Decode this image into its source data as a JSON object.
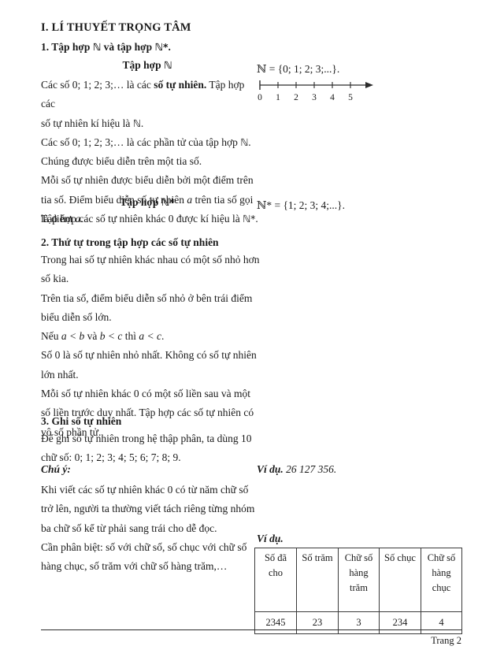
{
  "document": {
    "title": "I. LÍ THUYẾT TRỌNG TÂM",
    "footer_page": "Trang 2"
  },
  "sections": {
    "s1": {
      "heading_pre": "1. Tập hợp",
      "heading_mid": "và tập hợp",
      "sym_n": "ℕ",
      "sym_ns": "ℕ*",
      "heading_end": ".",
      "subhead_n_label": "Tập hợp",
      "subhead_ns_label": "Tập hợp",
      "p1_l1a": "Các số 0; 1; 2; 3;… là các ",
      "p1_l1b": "số tự nhiên.",
      "p1_l1c": " Tập hợp các",
      "p1_l2a": "số tự nhiên kí hiệu là ",
      "p1_l2b": ".",
      "p1_l3a": "Các số 0; 1; 2; 3;… là các phần tử của tập hợp ",
      "p1_l3b": ".",
      "p1_l4": "Chúng được biểu diễn trên một tia số.",
      "p1_l5": "Mỗi số tự nhiên được biểu diễn bởi một điểm trên",
      "p1_l6a": "tia số. Điểm biểu diễn số tự nhiên ",
      "p1_l6b": "a",
      "p1_l6c": " trên tia số gọi",
      "p1_l7a": "là điểm ",
      "p1_l7b": "a",
      "p1_l7c": ".",
      "p2_a": "Tập hợp các số tự nhiên khác 0 được kí hiệu là ",
      "p2_b": ".",
      "set_n": "ℕ = {0; 1; 2; 3;...}.",
      "set_ns": "ℕ* = {1; 2; 3; 4;...}."
    },
    "s2": {
      "heading": "2. Thứ tự trong tập hợp các số tự nhiên",
      "l1": "Trong hai số tự nhiên khác nhau có một số nhỏ hơn",
      "l2": "số kia.",
      "l3": "Trên tia số, điểm biểu diễn số nhỏ ở bên trái điểm",
      "l4": "biểu diễn số lớn.",
      "l5a": "Nếu ",
      "l5b": "a < b",
      "l5c": " và ",
      "l5d": "b < c",
      "l5e": " thì ",
      "l5f": "a < c",
      "l5g": ".",
      "l6": "Số 0 là số tự nhiên nhỏ nhất. Không có số tự nhiên",
      "l7": "lớn nhất.",
      "l8": "Mỗi số tự nhiên khác 0 có một số liền sau và một",
      "l9": "số liền trước duy nhất. Tập hợp các số tự nhiên có",
      "l10": "vô số phần tử."
    },
    "s3": {
      "heading": "3. Ghi số tự nhiên",
      "l1": "Để ghi số tự nhiên trong hệ thập phân, ta dùng 10",
      "l2": "chữ số: 0; 1; 2; 3; 4; 5; 6; 7; 8; 9.",
      "note_label": "Chú ý:",
      "n1": "Khi viết các số tự nhiên khác 0 có từ năm chữ số",
      "n2": "trở lên, người ta thường viết tách riêng từng nhóm",
      "n3": "ba chữ số kể từ phải sang trái cho dễ đọc.",
      "n4": "Cần phân biệt: số với chữ số, số chục với chữ số",
      "n5": "hàng chục, số trăm với chữ số hàng trăm,…"
    }
  },
  "examples": {
    "ex1_label": "Ví dụ.",
    "ex1_value": "26 127 356.",
    "ex2_label": "Ví dụ."
  },
  "number_line": {
    "ticks": [
      "0",
      "1",
      "2",
      "3",
      "4",
      "5"
    ]
  },
  "table": {
    "headers": [
      "Số đã cho",
      "Số trăm",
      "Chữ số hàng trăm",
      "Số chục",
      "Chữ số hàng chục"
    ],
    "header_lines": [
      [
        "Số đã",
        "cho"
      ],
      [
        "Số trăm"
      ],
      [
        "Chữ số",
        "hàng",
        "trăm"
      ],
      [
        "Số chục"
      ],
      [
        "Chữ số",
        "hàng",
        "chục"
      ]
    ],
    "rows": [
      [
        "2345",
        "23",
        "3",
        "234",
        "4"
      ]
    ]
  }
}
